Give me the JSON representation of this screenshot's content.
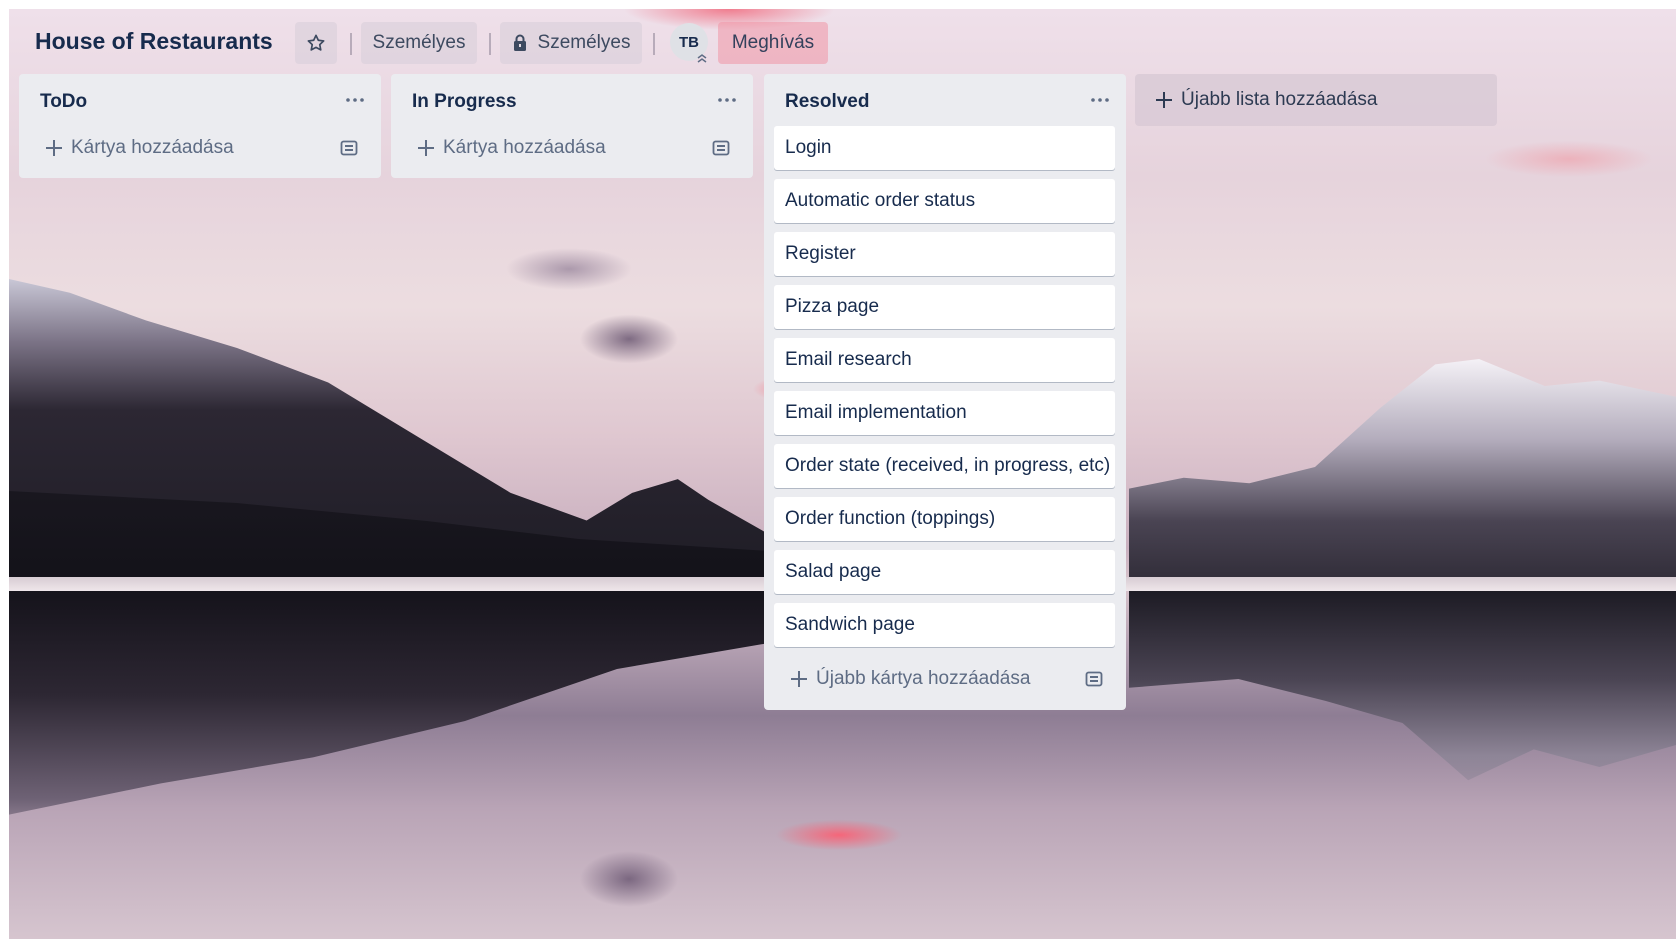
{
  "board": {
    "title": "House of Restaurants",
    "visibility_label": "Személyes",
    "workspace_label": "Személyes",
    "member_initials": "TB",
    "invite_label": "Meghívás"
  },
  "lists": [
    {
      "title": "ToDo",
      "add_card_label": "Kártya hozzáadása",
      "cards": []
    },
    {
      "title": "In Progress",
      "add_card_label": "Kártya hozzáadása",
      "cards": []
    },
    {
      "title": "Resolved",
      "add_card_label": "Újabb kártya hozzáadása",
      "cards": [
        "Login",
        "Automatic order status",
        "Register",
        "Pizza page",
        "Email research",
        "Email implementation",
        "Order state (received, in progress, etc)",
        "Order function (toppings)",
        "Salad page",
        "Sandwich page"
      ]
    }
  ],
  "add_list_label": "Újabb lista hozzáadása",
  "icons": {
    "star": "star-icon",
    "lock": "lock-icon",
    "menu": "more-horizontal-icon",
    "plus": "plus-icon",
    "template": "card-template-icon"
  }
}
